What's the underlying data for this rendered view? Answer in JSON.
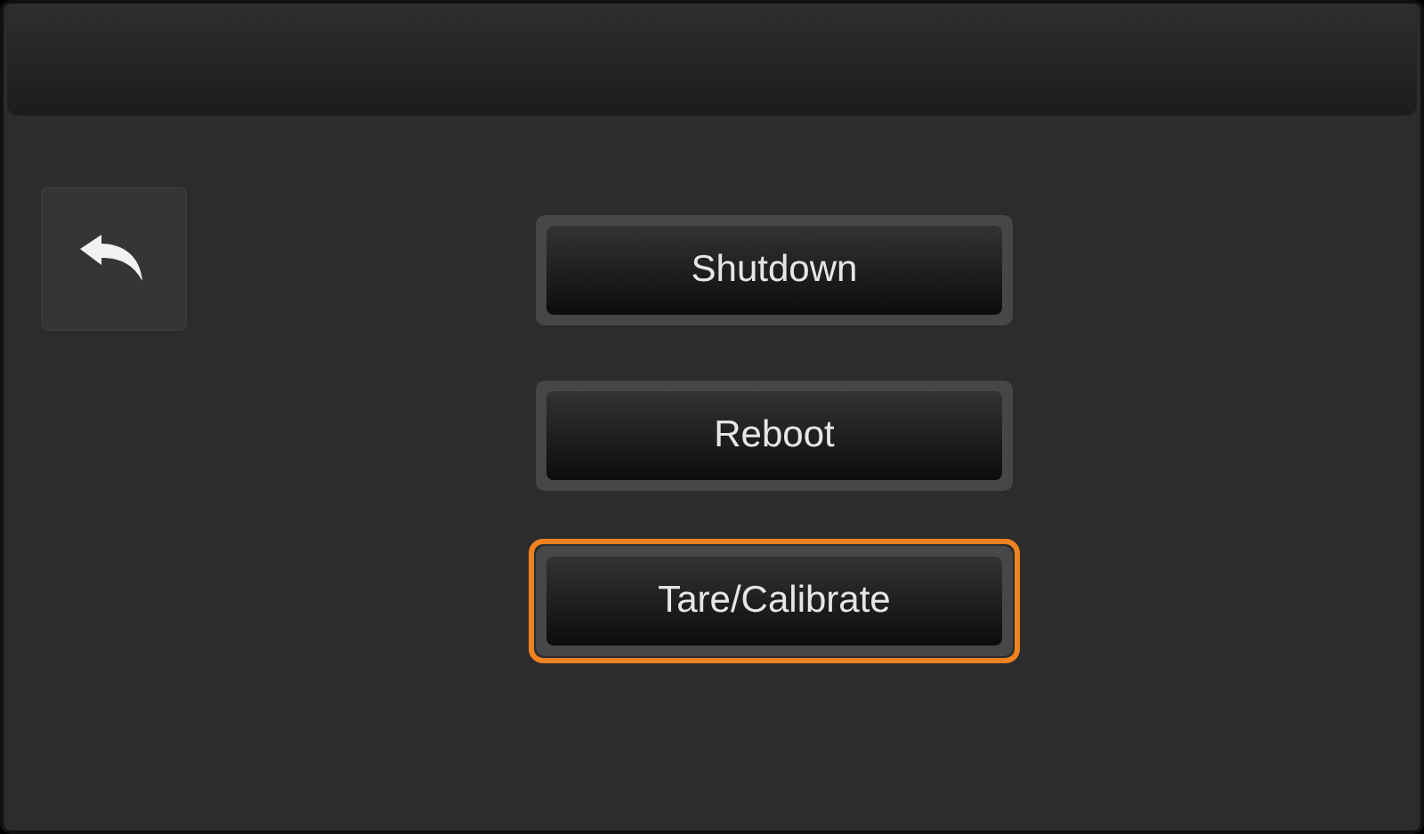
{
  "buttons": [
    {
      "label": "Shutdown",
      "selected": false
    },
    {
      "label": "Reboot",
      "selected": false
    },
    {
      "label": "Tare/Calibrate",
      "selected": true
    }
  ]
}
